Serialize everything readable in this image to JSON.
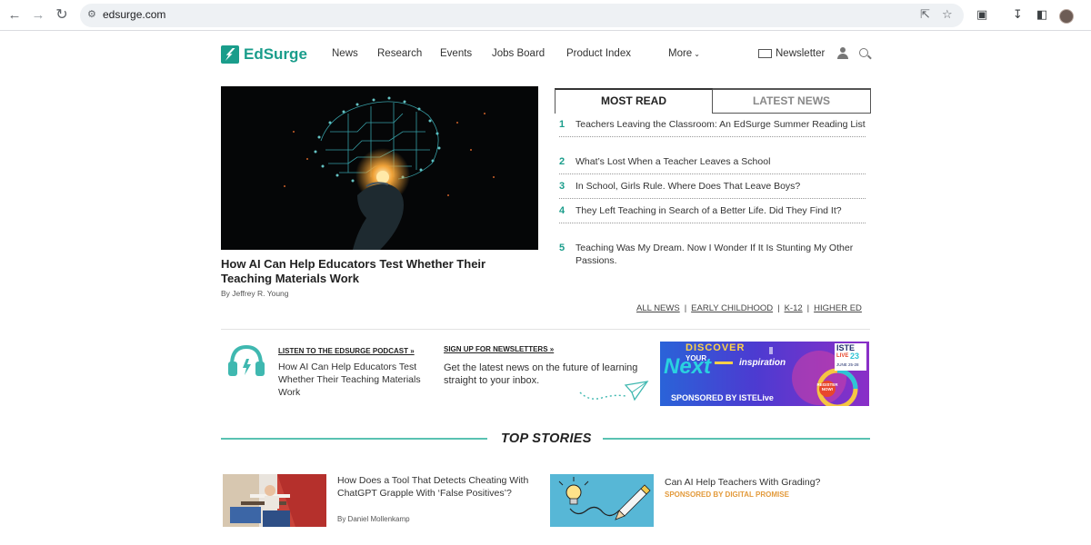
{
  "browser": {
    "url": "edsurge.com",
    "icons": [
      "back-icon",
      "forward-icon",
      "reload-icon",
      "site-info-icon",
      "share-icon",
      "bookmark-star-icon",
      "extensions-icon",
      "downloads-icon",
      "sidepanel-icon",
      "profile-avatar"
    ]
  },
  "site": {
    "brand": "EdSurge",
    "accent_color": "#1a9d8b",
    "nav": [
      "News",
      "Research",
      "Events",
      "Jobs Board",
      "Product Index"
    ],
    "more_label": "More",
    "newsletter_label": "Newsletter"
  },
  "hero": {
    "title": "How AI Can Help Educators Test Whether Their Teaching Materials Work",
    "byline": "By Jeffrey R. Young"
  },
  "tabs": {
    "most_read": "MOST READ",
    "latest_news": "LATEST NEWS"
  },
  "most_read": [
    {
      "num": "1",
      "title": "Teachers Leaving the Classroom: An EdSurge Summer Reading List"
    },
    {
      "num": "2",
      "title": "What’s Lost When a Teacher Leaves a School"
    },
    {
      "num": "3",
      "title": "In School, Girls Rule. Where Does That Leave Boys?"
    },
    {
      "num": "4",
      "title": "They Left Teaching in Search of a Better Life. Did They Find It?"
    },
    {
      "num": "5",
      "title": "Teaching Was My Dream. Now I Wonder If It Is Stunting My Other Passions."
    }
  ],
  "categories": [
    "ALL NEWS",
    "EARLY CHILDHOOD",
    "K-12",
    "HIGHER ED"
  ],
  "category_separator": "|",
  "podcast": {
    "label": "LISTEN TO THE EDSURGE PODCAST »",
    "text": "How AI Can Help Educators Test Whether Their Teaching Materials Work"
  },
  "newsletter_promo": {
    "label": "SIGN UP FOR NEWSLETTERS »",
    "text": "Get the latest news on the future of learning straight to your inbox."
  },
  "ad": {
    "discover": "DISCOVER",
    "your": "YOUR",
    "next": "Next",
    "inspiration": "inspiration",
    "brand": "ISTE",
    "live": "LIVE",
    "year": "23",
    "dates": "JUNE 25-28",
    "sponsor": "SPONSORED BY ISTELive",
    "register": "REGISTER NOW!"
  },
  "top_stories": {
    "heading": "TOP STORIES",
    "items": [
      {
        "title": "How Does a Tool That Detects Cheating With ChatGPT Grapple With ‘False Positives’?",
        "byline": "By Daniel Mollenkamp"
      },
      {
        "title": "Can AI Help Teachers With Grading?",
        "sponsor": "SPONSORED BY DIGITAL PROMISE"
      }
    ]
  }
}
